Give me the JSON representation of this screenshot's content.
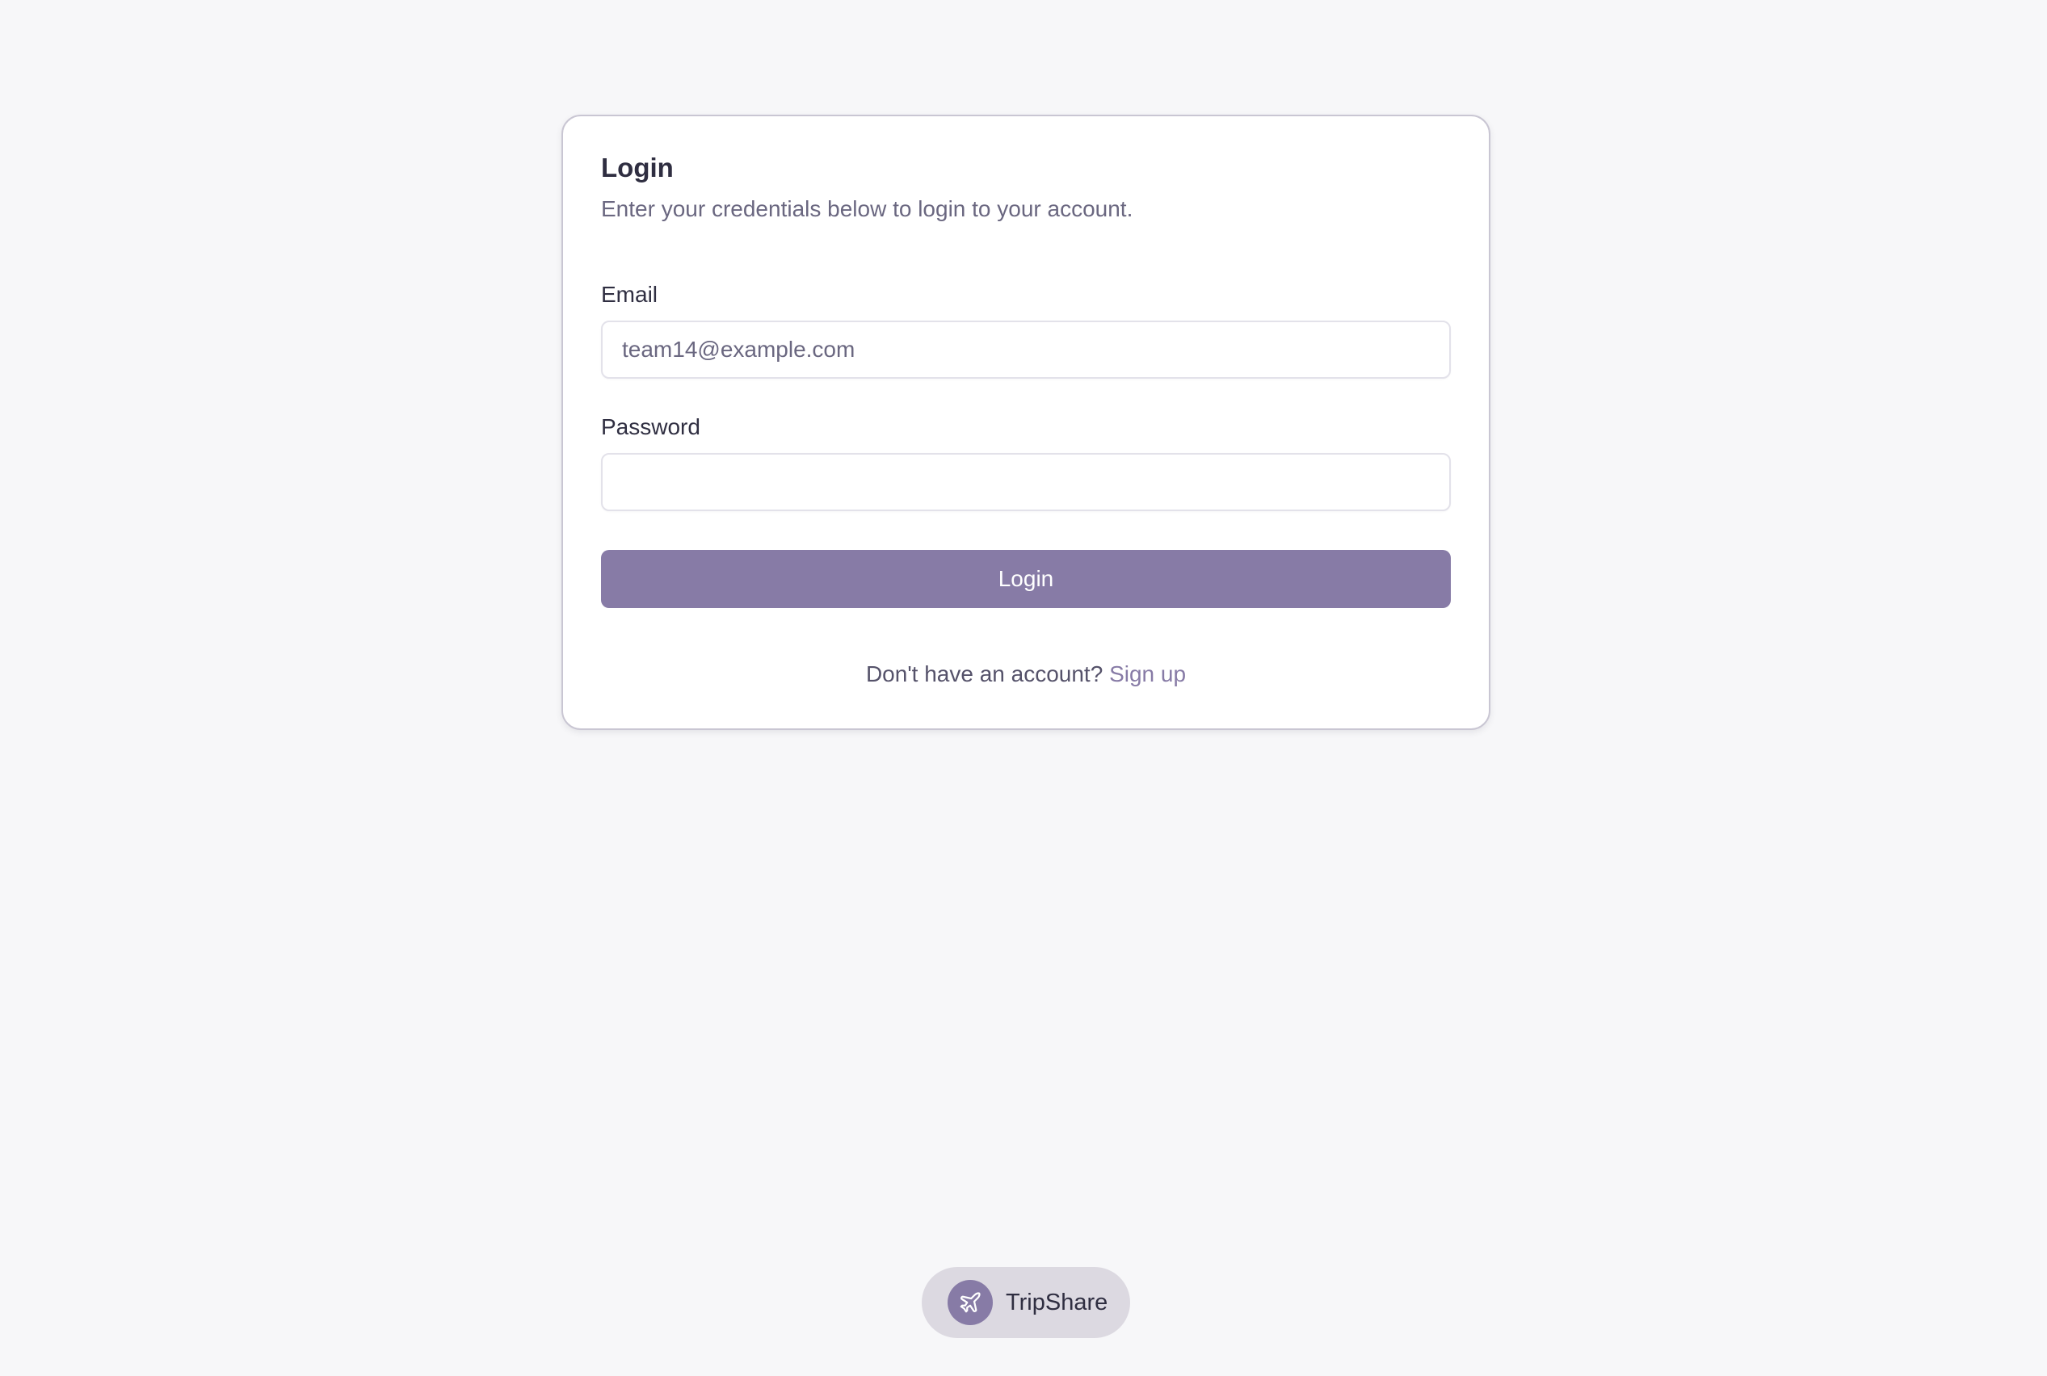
{
  "login_card": {
    "title": "Login",
    "description": "Enter your credentials below to login to your account.",
    "email": {
      "label": "Email",
      "value": "",
      "placeholder": "team14@example.com"
    },
    "password": {
      "label": "Password",
      "value": "",
      "placeholder": ""
    },
    "submit_label": "Login",
    "signup_prompt": "Don't have an account?",
    "signup_link": "Sign up"
  },
  "brand": {
    "name": "TripShare",
    "icon": "plane-icon"
  },
  "colors": {
    "accent": "#877ba6",
    "background": "#f7f7f9",
    "card": "#ffffff",
    "text": "#2f2e41",
    "muted_text": "#6a6780",
    "brand_pill": "#dcd9e1"
  }
}
